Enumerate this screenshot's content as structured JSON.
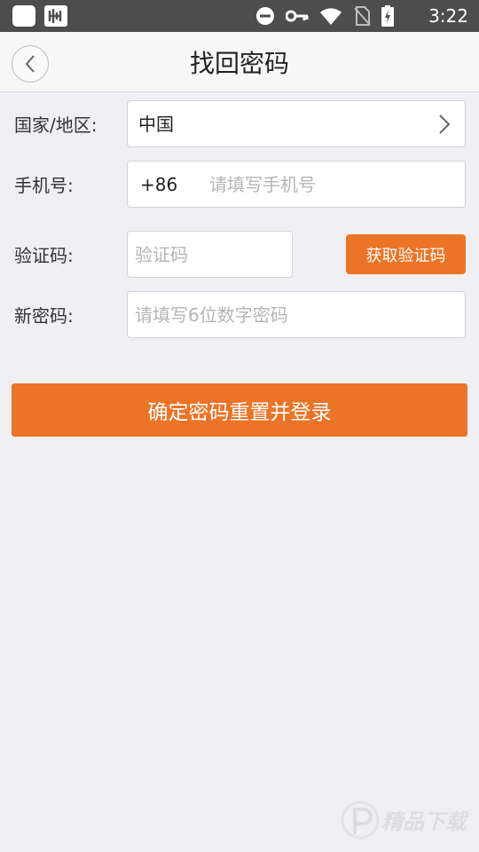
{
  "status_bar": {
    "time": "3:22",
    "icons": [
      "app-square-icon",
      "app-logo-icon",
      "do-not-disturb-icon",
      "vpn-key-icon",
      "wifi-icon",
      "no-sim-icon",
      "battery-charging-icon"
    ]
  },
  "header": {
    "title": "找回密码",
    "back_icon": "chevron-left-icon"
  },
  "form": {
    "country_label": "国家/地区:",
    "country_value": "中国",
    "phone_label": "手机号:",
    "phone_prefix": "+86",
    "phone_placeholder": "请填写手机号",
    "code_label": "验证码:",
    "code_placeholder": "验证码",
    "get_code_button": "获取验证码",
    "password_label": "新密码:",
    "password_placeholder": "请填写6位数字密码"
  },
  "submit_button": "确定密码重置并登录",
  "watermark": {
    "text": "精品下载"
  },
  "colors": {
    "accent": "#ec7426",
    "background": "#efeff4",
    "status_bar": "#4d4d4d"
  }
}
